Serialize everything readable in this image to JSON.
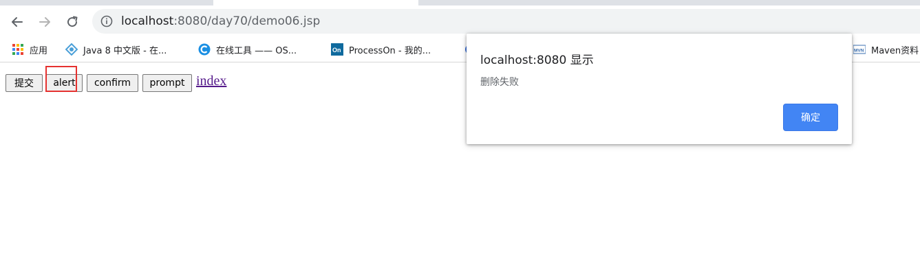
{
  "browser": {
    "url_host": "localhost",
    "url_rest": ":8080/day70/demo06.jsp",
    "bookmarks": [
      {
        "label": "应用",
        "icon": "apps-grid-icon"
      },
      {
        "label": "Java 8 中文版 - 在...",
        "icon": "java-doc-icon"
      },
      {
        "label": "在线工具 —— OS...",
        "icon": "oschina-icon"
      },
      {
        "label": "ProcessOn - 我的...",
        "icon": "processon-icon"
      },
      {
        "label": "Maven资料",
        "icon": "maven-icon"
      }
    ]
  },
  "page": {
    "buttons": [
      {
        "label": "提交"
      },
      {
        "label": "alert"
      },
      {
        "label": "confirm"
      },
      {
        "label": "prompt"
      }
    ],
    "link": "index"
  },
  "dialog": {
    "title": "localhost:8080 显示",
    "message": "删除失败",
    "ok_label": "确定"
  },
  "colors": {
    "accent": "#4285f4",
    "highlight_box": "#e5312f",
    "visited_link": "#551a8b"
  }
}
